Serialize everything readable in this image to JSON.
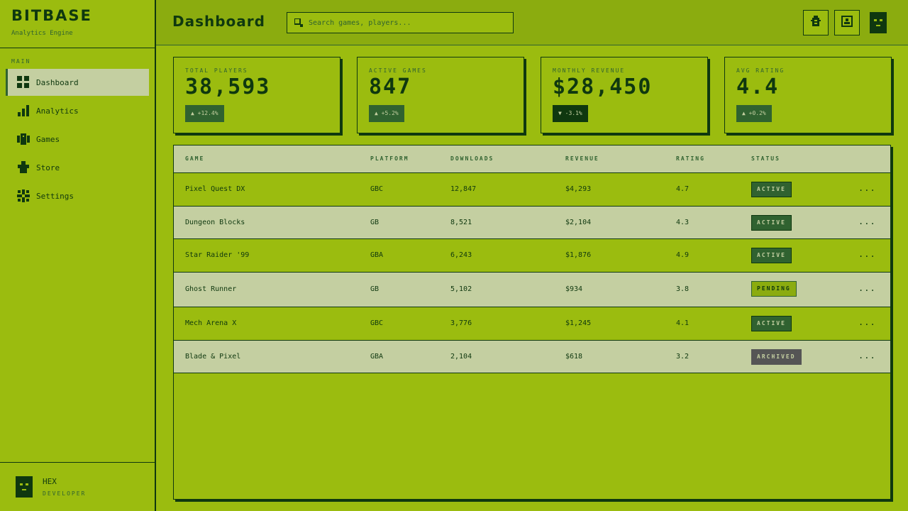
{
  "brand": {
    "title": "BITBASE",
    "subtitle": "Analytics Engine"
  },
  "sidebar": {
    "section_label": "MAIN",
    "items": [
      {
        "label": "Dashboard",
        "icon": "grid-icon",
        "active": true
      },
      {
        "label": "Analytics",
        "icon": "bar-chart-icon",
        "active": false
      },
      {
        "label": "Games",
        "icon": "gamepad-icon",
        "active": false
      },
      {
        "label": "Store",
        "icon": "puzzle-icon",
        "active": false
      },
      {
        "label": "Settings",
        "icon": "gear-icon",
        "active": false
      }
    ],
    "user": {
      "name": "HEX",
      "role": "DEVELOPER"
    }
  },
  "header": {
    "title": "Dashboard",
    "search_placeholder": "Search games, players...",
    "buttons": [
      "bug-icon",
      "user-card-icon"
    ]
  },
  "stats": [
    {
      "label": "TOTAL PLAYERS",
      "value": "38,593",
      "change": "▲ +12.4%",
      "direction": "up"
    },
    {
      "label": "ACTIVE GAMES",
      "value": "847",
      "change": "▲ +5.2%",
      "direction": "up"
    },
    {
      "label": "MONTHLY REVENUE",
      "value": "$28,450",
      "change": "▼ -3.1%",
      "direction": "down"
    },
    {
      "label": "AVG RATING",
      "value": "4.4",
      "change": "▲ +0.2%",
      "direction": "up"
    }
  ],
  "table": {
    "columns": [
      "GAME",
      "PLATFORM",
      "DOWNLOADS",
      "REVENUE",
      "RATING",
      "STATUS"
    ],
    "rows": [
      {
        "game": "Pixel Quest DX",
        "platform": "GBC",
        "downloads": "12,847",
        "revenue": "$4,293",
        "rating": "4.7",
        "status": "ACTIVE",
        "status_type": "active"
      },
      {
        "game": "Dungeon Blocks",
        "platform": "GB",
        "downloads": "8,521",
        "revenue": "$2,104",
        "rating": "4.3",
        "status": "ACTIVE",
        "status_type": "active"
      },
      {
        "game": "Star Raider '99",
        "platform": "GBA",
        "downloads": "6,243",
        "revenue": "$1,876",
        "rating": "4.9",
        "status": "ACTIVE",
        "status_type": "active"
      },
      {
        "game": "Ghost Runner",
        "platform": "GB",
        "downloads": "5,102",
        "revenue": "$934",
        "rating": "3.8",
        "status": "PENDING",
        "status_type": "pending"
      },
      {
        "game": "Mech Arena X",
        "platform": "GBC",
        "downloads": "3,776",
        "revenue": "$1,245",
        "rating": "4.1",
        "status": "ACTIVE",
        "status_type": "active"
      },
      {
        "game": "Blade & Pixel",
        "platform": "GBA",
        "downloads": "2,104",
        "revenue": "$618",
        "rating": "3.2",
        "status": "ARCHIVED",
        "status_type": "archived"
      }
    ],
    "row_action": "..."
  }
}
